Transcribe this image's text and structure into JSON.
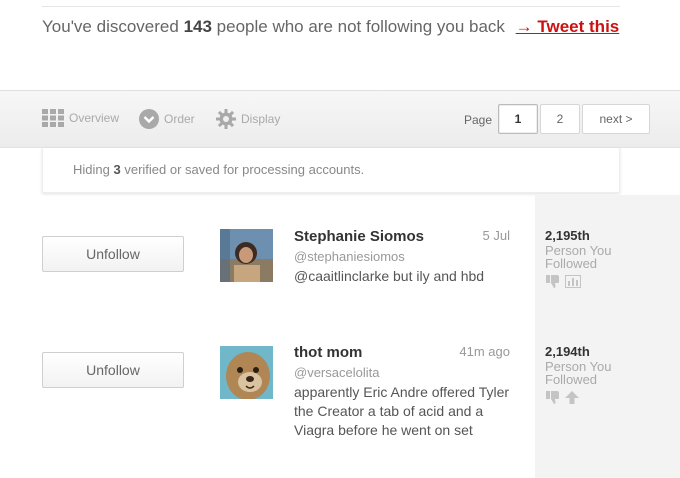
{
  "header": {
    "text_before": "You've discovered",
    "count": "143",
    "text_after": "people who are not following you back",
    "tweet_link": "→ Tweet this"
  },
  "toolbar": {
    "tools": [
      {
        "label": "Overview",
        "icon": "grid-icon"
      },
      {
        "label": "Order",
        "icon": "chevron-down-circle-icon"
      },
      {
        "label": "Display",
        "icon": "gear-icon"
      }
    ],
    "page_label": "Page",
    "pages": [
      "1",
      "2"
    ],
    "current_page": "1",
    "next_label": "next >"
  },
  "notice": {
    "before": "Hiding",
    "count": "3",
    "after": "verified or saved for processing accounts."
  },
  "rows": [
    {
      "button_label": "Unfollow",
      "name": "Stephanie Siomos",
      "time": "5 Jul",
      "handle": "@stephaniesiomos",
      "tweet": "@caaitlinclarke but ily and hbd",
      "rank": "2,195th",
      "rank_label": "Person You Followed",
      "icons": [
        "thumbs-down-icon",
        "bar-chart-icon"
      ]
    },
    {
      "button_label": "Unfollow",
      "name": "thot mom",
      "time": "41m ago",
      "handle": "@versacelolita",
      "tweet": "apparently Eric Andre offered Tyler the Creator a tab of acid and a Viagra before he went on set",
      "rank": "2,194th",
      "rank_label": "Person You Followed",
      "icons": [
        "thumbs-down-icon",
        "arrow-up-icon"
      ]
    }
  ],
  "colors": {
    "accent": "#cc1111",
    "toolbar_bg": "#f0f0f0",
    "rank_column_bg": "#f3f3f3"
  }
}
